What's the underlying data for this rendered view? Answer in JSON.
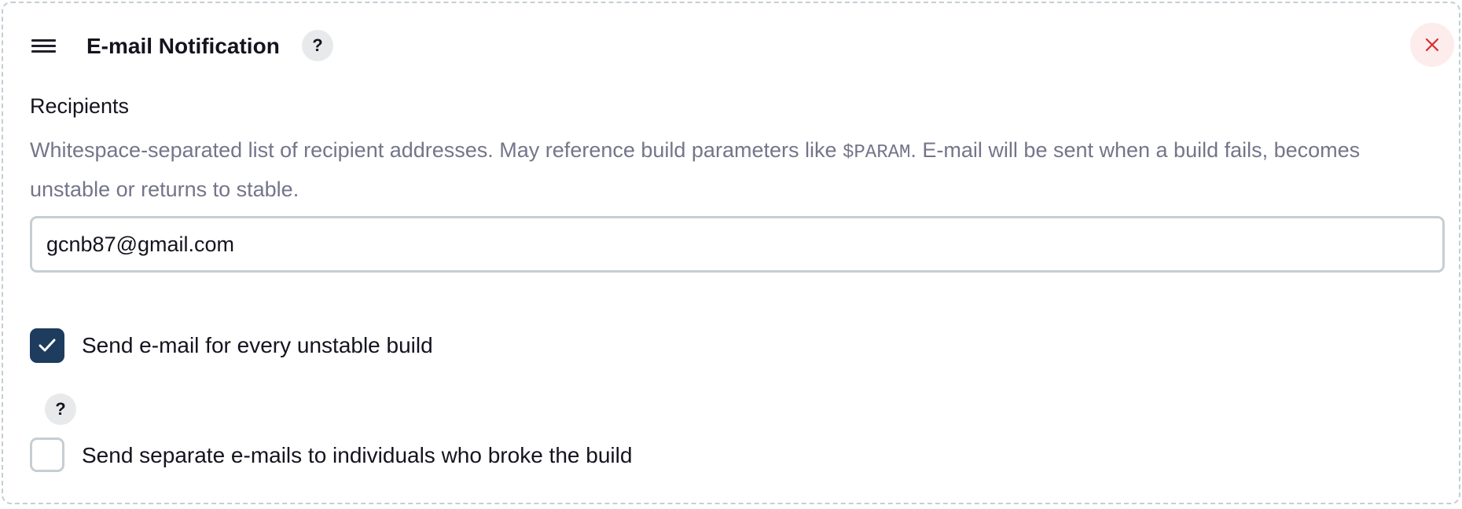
{
  "section": {
    "title": "E-mail Notification",
    "help_icon": "?",
    "drag_icon": "hamburger-icon",
    "close_icon": "close-x-icon",
    "close_color": "#d32f2f"
  },
  "recipients": {
    "label": "Recipients",
    "description_before": "Whitespace-separated list of recipient addresses. May reference build parameters like ",
    "description_code": "$PARAM",
    "description_after": ". E-mail will be sent when a build fails, becomes unstable or returns to stable.",
    "value": "gcnb87@gmail.com"
  },
  "options": [
    {
      "label": "Send e-mail for every unstable build",
      "checked": true
    },
    {
      "help_icon": "?",
      "label": "Send separate e-mails to individuals who broke the build",
      "checked": false
    }
  ],
  "colors": {
    "checkbox_checked": "#1d3c5e",
    "border": "#c5ced3",
    "muted_text": "#74758a"
  }
}
